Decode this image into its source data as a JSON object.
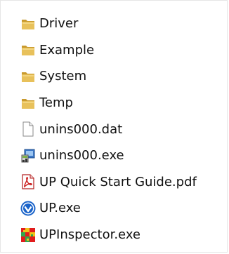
{
  "colors": {
    "folder": "#e8c15b",
    "folder_dark": "#c99a2e",
    "pdf_red": "#cc1f1f",
    "up_blue": "#1a63c9",
    "text": "#111111"
  },
  "files": [
    {
      "name": "Driver",
      "icon": "folder-icon"
    },
    {
      "name": "Example",
      "icon": "folder-icon"
    },
    {
      "name": "System",
      "icon": "folder-icon"
    },
    {
      "name": "Temp",
      "icon": "folder-icon"
    },
    {
      "name": "unins000.dat",
      "icon": "document-icon"
    },
    {
      "name": "unins000.exe",
      "icon": "installer-icon"
    },
    {
      "name": "UP Quick Start Guide.pdf",
      "icon": "pdf-icon"
    },
    {
      "name": "UP.exe",
      "icon": "up-app-icon"
    },
    {
      "name": "UPInspector.exe",
      "icon": "inspector-app-icon"
    }
  ]
}
